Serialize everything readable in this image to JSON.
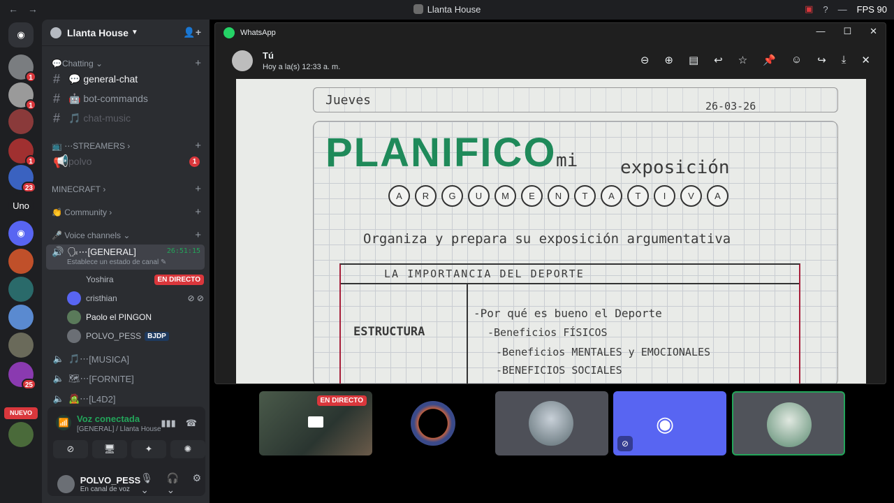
{
  "titlebar": {
    "title": "Llanta House",
    "back": "←",
    "forward": "→",
    "fps": "FPS 90",
    "minimize": "—",
    "help": "?"
  },
  "servers": {
    "badges": [
      "1",
      "1",
      "1",
      "1",
      "23",
      "25"
    ],
    "uno_label": "Uno",
    "nuevo_label": "NUEVO"
  },
  "guild": {
    "name": "Llanta House"
  },
  "sidebar": {
    "cat_chatting": "Chatting",
    "chan_general": "general-chat",
    "chan_bot": "bot-commands",
    "chan_music": "chat-music",
    "cat_streamers": "STREAMERS",
    "chan_polvo": "polvo",
    "chan_polvo_badge": "1",
    "cat_minecraft": "MINECRAFT",
    "cat_community": "Community",
    "cat_voice": "Voice channels",
    "voice_general": "[GENERAL]",
    "voice_timer": "26:51:15",
    "voice_status": "Establece un estado de canal",
    "users": [
      {
        "name": "Yoshira",
        "tag": "EN DIRECTO"
      },
      {
        "name": "cristhian"
      },
      {
        "name": "Paolo el PINGON"
      },
      {
        "name": "POLVO_PESS",
        "game": "BJDP"
      }
    ],
    "voice_musica": "[MUSICA]",
    "voice_fornite": "[FORNITE]",
    "voice_l4d2": "[L4D2]"
  },
  "voice_panel": {
    "title": "Voz conectada",
    "subtitle": "[GENERAL] / Llanta House"
  },
  "user_panel": {
    "name": "POLVO_PESS",
    "status": "En canal de voz"
  },
  "whatsapp": {
    "app": "WhatsApp",
    "sender": "Tú",
    "timestamp": "Hoy a la(s) 12:33 a. m.",
    "photo": {
      "day": "Jueves",
      "date": "26-03-26",
      "title": "PLANIFICO",
      "mi": "mi",
      "exposicion": "exposición",
      "letters": [
        "A",
        "R",
        "G",
        "U",
        "M",
        "E",
        "N",
        "T",
        "A",
        "T",
        "I",
        "V",
        "A"
      ],
      "line1": "Organiza y prepara su exposición argumentativa",
      "table_header": "LA IMPORTANCIA DEL DEPORTE",
      "row_label": "ESTRUCTURA",
      "bullets": [
        "-Por qué es bueno el Deporte",
        "-Beneficios FÍSICOS",
        "-Beneficios MENTALES y EMOCIONALES",
        "-BENEFICIOS SOCIALES"
      ]
    }
  },
  "thumbs": {
    "live_label": "EN DIRECTO"
  }
}
